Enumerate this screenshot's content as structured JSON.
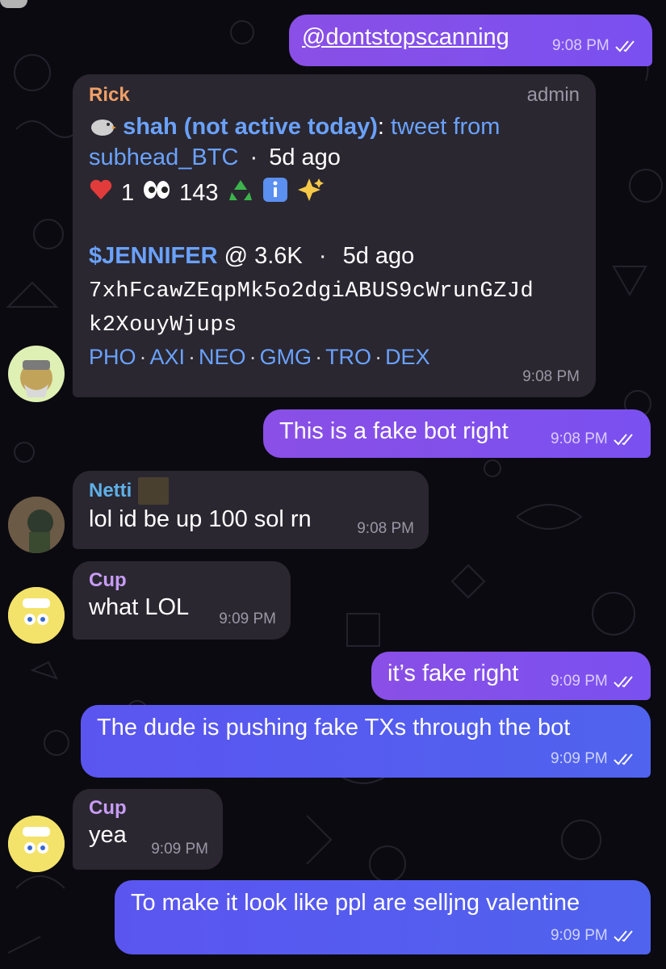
{
  "messages": {
    "m1": {
      "text": "@dontstopscanning",
      "time": "9:08 PM"
    },
    "rick": {
      "sender": "Rick",
      "role": "admin",
      "tweeter": "shah (not active today)",
      "colon": ":",
      "tweet_from": "tweet from",
      "handle": "subhead_BTC",
      "dot": "·",
      "age": "5d ago",
      "heart_count": "1",
      "eyes_count": "143",
      "token": "$JENNIFER",
      "mcap": "@ 3.6K",
      "token_age": "5d ago",
      "address_line1": "7xhFcawZEqpMk5o2dgiABUS9cWrunGZJd",
      "address_line2": "k2XouyWjups",
      "links": [
        "PHO",
        "AXI",
        "NEO",
        "GMG",
        "TRO",
        "DEX"
      ],
      "time": "9:08 PM"
    },
    "m3": {
      "text": "This is a fake bot right",
      "time": "9:08 PM"
    },
    "netti": {
      "sender": "Netti",
      "text": "lol id be up 100 sol rn",
      "time": "9:08 PM"
    },
    "cup1": {
      "sender": "Cup",
      "text": "what LOL",
      "time": "9:09 PM"
    },
    "m6": {
      "text": "it’s fake right",
      "time": "9:09 PM"
    },
    "m7": {
      "text": "The dude is pushing fake TXs through the bot",
      "time": "9:09 PM"
    },
    "cup2": {
      "sender": "Cup",
      "text": "yea",
      "time": "9:09 PM"
    },
    "m9": {
      "text": "To make it look like ppl are selljng valentine",
      "time": "9:09 PM"
    }
  },
  "icons": {
    "bird": "bird-icon",
    "heart": "heart-icon",
    "eyes": "eyes-icon",
    "recycle": "recycle-icon",
    "info": "info-icon",
    "sparkles": "sparkles-icon",
    "read_ticks": "double-check-icon"
  },
  "colors": {
    "background": "#0b0a10",
    "outgoing_purple": "#8a4fe6",
    "outgoing_blue": "#5b55f0",
    "incoming": "#2a2730",
    "rick_name": "#f0a068",
    "netti_name": "#5fb0e8",
    "cup_name": "#c79cf5",
    "link": "#6aa2ff"
  }
}
